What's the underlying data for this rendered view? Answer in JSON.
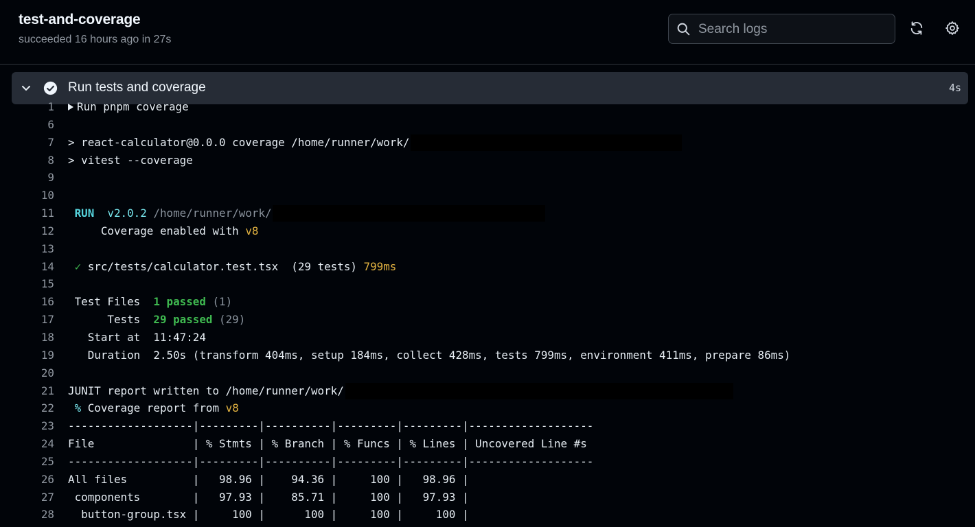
{
  "header": {
    "job_title": "test-and-coverage",
    "job_status": "succeeded 16 hours ago in 27s",
    "search_placeholder": "Search logs"
  },
  "step": {
    "title": "Run tests and coverage",
    "duration": "4s"
  },
  "log_lines": [
    {
      "n": "1",
      "segs": [
        {
          "t": "Run pnpm coverage",
          "c": ""
        }
      ],
      "caret": true
    },
    {
      "n": "6",
      "segs": []
    },
    {
      "n": "7",
      "segs": [
        {
          "t": "> react-calculator@0.0.0 coverage /home/runner/work/",
          "c": ""
        }
      ],
      "redact": [
        598,
        395
      ]
    },
    {
      "n": "8",
      "segs": [
        {
          "t": "> vitest --coverage",
          "c": ""
        }
      ]
    },
    {
      "n": "9",
      "segs": []
    },
    {
      "n": "10",
      "segs": []
    },
    {
      "n": "11",
      "segs": [
        {
          "t": " RUN ",
          "c": "c-cyan-b"
        },
        {
          "t": " v2.0.2 ",
          "c": "c-cyan"
        },
        {
          "t": "/home/runner/work/",
          "c": "c-dim"
        }
      ],
      "redact": [
        397,
        397
      ]
    },
    {
      "n": "12",
      "segs": [
        {
          "t": "     Coverage enabled with ",
          "c": ""
        },
        {
          "t": "v8",
          "c": "c-yellow"
        }
      ]
    },
    {
      "n": "13",
      "segs": []
    },
    {
      "n": "14",
      "segs": [
        {
          "t": " ✓",
          "c": "c-green"
        },
        {
          "t": " src/tests/calculator.test.tsx  (29 tests) ",
          "c": ""
        },
        {
          "t": "799ms",
          "c": "c-yellow"
        }
      ]
    },
    {
      "n": "15",
      "segs": []
    },
    {
      "n": "16",
      "segs": [
        {
          "t": " Test Files  ",
          "c": ""
        },
        {
          "t": "1 passed",
          "c": "c-green-b"
        },
        {
          "t": " (1)",
          "c": "c-dim"
        }
      ]
    },
    {
      "n": "17",
      "segs": [
        {
          "t": "      Tests  ",
          "c": ""
        },
        {
          "t": "29 passed",
          "c": "c-green-b"
        },
        {
          "t": " (29)",
          "c": "c-dim"
        }
      ]
    },
    {
      "n": "18",
      "segs": [
        {
          "t": "   Start at  11:47:24",
          "c": ""
        }
      ]
    },
    {
      "n": "19",
      "segs": [
        {
          "t": "   Duration  2.50s (transform 404ms, setup 184ms, collect 428ms, tests 799ms, environment 411ms, prepare 86ms)",
          "c": ""
        }
      ]
    },
    {
      "n": "20",
      "segs": []
    },
    {
      "n": "21",
      "segs": [
        {
          "t": "JUNIT report written to /home/runner/work/",
          "c": ""
        }
      ],
      "redact": [
        503,
        565
      ]
    },
    {
      "n": "22",
      "segs": [
        {
          "t": " %",
          "c": "c-cyan"
        },
        {
          "t": " Coverage report from ",
          "c": ""
        },
        {
          "t": "v8",
          "c": "c-yellow"
        }
      ]
    },
    {
      "n": "23",
      "segs": [
        {
          "t": "-------------------|---------|----------|---------|---------|-------------------",
          "c": ""
        }
      ]
    },
    {
      "n": "24",
      "segs": [
        {
          "t": "File               | % Stmts | % Branch | % Funcs | % Lines | Uncovered Line #s",
          "c": ""
        }
      ]
    },
    {
      "n": "25",
      "segs": [
        {
          "t": "-------------------|---------|----------|---------|---------|-------------------",
          "c": ""
        }
      ]
    },
    {
      "n": "26",
      "segs": [
        {
          "t": "All files          |   98.96 |    94.36 |     100 |   98.96 |",
          "c": ""
        }
      ]
    },
    {
      "n": "27",
      "segs": [
        {
          "t": " components        |   97.93 |    85.71 |     100 |   97.93 |",
          "c": ""
        }
      ]
    },
    {
      "n": "28",
      "segs": [
        {
          "t": "  button-group.tsx |     100 |      100 |     100 |     100 |",
          "c": ""
        }
      ]
    }
  ]
}
